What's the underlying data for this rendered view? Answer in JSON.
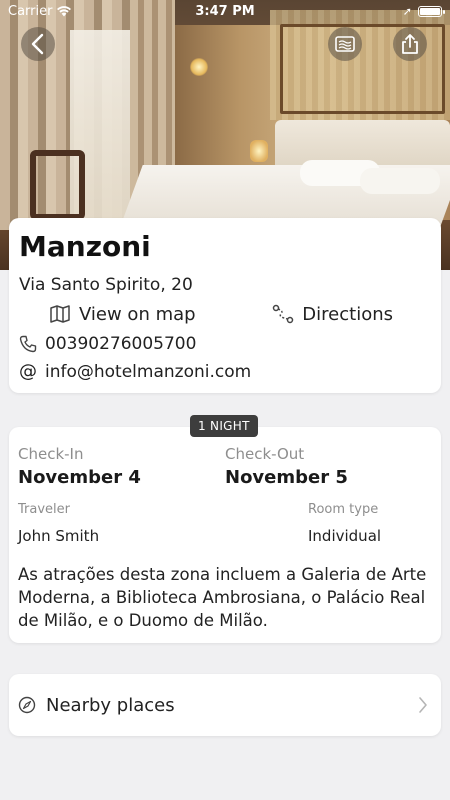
{
  "status_bar": {
    "carrier": "Carrier",
    "time": "3:47 PM",
    "location_glyph": "➚",
    "wifi_icon": "wifi-icon",
    "battery_level": 1.0
  },
  "header_photo": {
    "nav_icons": [
      "back-chevron-icon",
      "ticket-icon",
      "share-icon"
    ]
  },
  "hotel": {
    "name": "Manzoni",
    "address": "Via Santo Spirito, 20",
    "view_on_map_label": "View on map",
    "directions_label": "Directions",
    "phone": "00390276005700",
    "email": "info@hotelmanzoni.com"
  },
  "stay": {
    "nights_badge": "1 NIGHT",
    "check_in_label": "Check-In",
    "check_in_date": "November 4",
    "check_out_label": "Check-Out",
    "check_out_date": "November 5",
    "traveler_label": "Traveler",
    "traveler_name": "John Smith",
    "room_type_label": "Room type",
    "room_type": "Individual",
    "description": "As atrações desta zona incluem a Galeria de Arte Moderna, a Biblioteca Ambrosiana, o Palácio Real de Milão, e o Duomo de Milão."
  },
  "nearby": {
    "label": "Nearby places",
    "icon": "compass-icon"
  },
  "colors": {
    "background": "#f0f0f2",
    "card": "#ffffff",
    "badge": "#3d3d3d",
    "muted_text": "#8e8e8e"
  }
}
